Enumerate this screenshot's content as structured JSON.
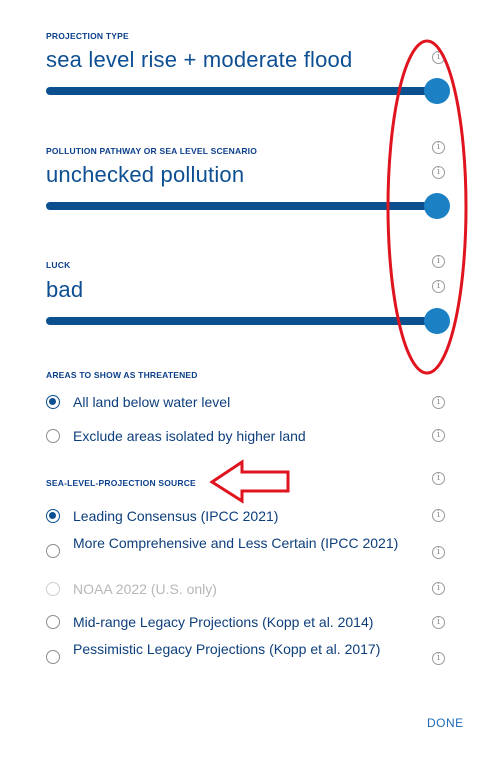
{
  "projection": {
    "label": "PROJECTION TYPE",
    "value": "sea level rise + moderate flood",
    "slider_level": 1.0
  },
  "pollution": {
    "label": "POLLUTION PATHWAY OR SEA LEVEL SCENARIO",
    "value": "unchecked pollution",
    "slider_level": 1.0
  },
  "luck": {
    "label": "LUCK",
    "value": "bad",
    "slider_level": 1.0
  },
  "areas": {
    "label": "AREAS TO SHOW AS THREATENED",
    "options": [
      {
        "label": "All land below water level",
        "selected": true
      },
      {
        "label": "Exclude areas isolated by higher land",
        "selected": false
      }
    ]
  },
  "source": {
    "label": "SEA-LEVEL-PROJECTION SOURCE",
    "options": [
      {
        "label": "Leading Consensus (IPCC 2021)",
        "selected": true,
        "disabled": false
      },
      {
        "label": "More Comprehensive and Less Certain (IPCC 2021)",
        "selected": false,
        "disabled": false
      },
      {
        "label": "NOAA 2022 (U.S. only)",
        "selected": false,
        "disabled": true
      },
      {
        "label": "Mid-range Legacy Projections (Kopp et al. 2014)",
        "selected": false,
        "disabled": false
      },
      {
        "label": "Pessimistic Legacy Projections (Kopp et al. 2017)",
        "selected": false,
        "disabled": false
      }
    ]
  },
  "info_glyph": "i",
  "done_label": "DONE",
  "colors": {
    "primary": "#0b4f8e",
    "thumb": "#1b80c4",
    "annotation": "#e0141e"
  }
}
